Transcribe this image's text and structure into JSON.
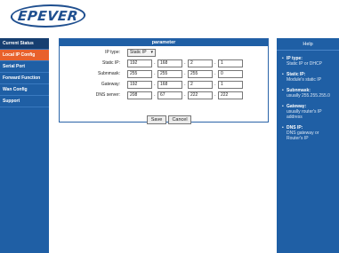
{
  "brand": {
    "logo_text": "EPEVER"
  },
  "sidebar": {
    "items": [
      {
        "label": "Current Status",
        "type": "group"
      },
      {
        "label": "Local IP Config",
        "type": "active"
      },
      {
        "label": "Serial Port",
        "type": "normal"
      },
      {
        "label": "Forward Function",
        "type": "normal"
      },
      {
        "label": "Wan Config",
        "type": "normal"
      },
      {
        "label": "Support",
        "type": "normal"
      }
    ]
  },
  "panel": {
    "title": "parameter",
    "ip_type": {
      "label": "IP type:",
      "value": "Static IP"
    },
    "rows": [
      {
        "label": "Static IP:",
        "octets": [
          "192",
          "168",
          "2",
          "1"
        ]
      },
      {
        "label": "Subnmask:",
        "octets": [
          "255",
          "255",
          "255",
          "0"
        ]
      },
      {
        "label": "Gateway:",
        "octets": [
          "192",
          "168",
          "2",
          "1"
        ]
      },
      {
        "label": "DNS server:",
        "octets": [
          "208",
          "67",
          "222",
          "222"
        ]
      }
    ],
    "save_label": "Save",
    "cancel_label": "Cancel"
  },
  "help": {
    "title": "Help",
    "items": [
      {
        "title": "IP type:",
        "desc": "Static IP or DHCP"
      },
      {
        "title": "Static IP:",
        "desc": "Module's static IP"
      },
      {
        "title": "Subnmask:",
        "desc": "usually 255.255.255.0"
      },
      {
        "title": "Gateway:",
        "desc": "usually router's IP address"
      },
      {
        "title": "DNS IP:",
        "desc": "DNS gateway or Router's IP"
      }
    ]
  }
}
